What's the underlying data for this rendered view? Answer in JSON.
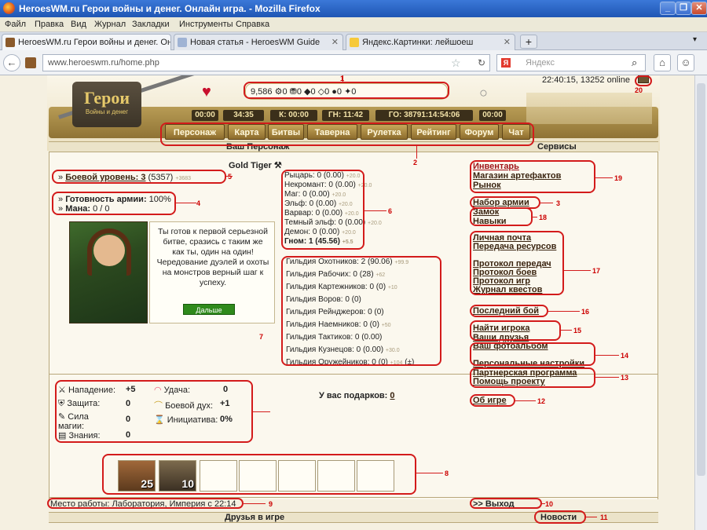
{
  "browser": {
    "window_title": "HeroesWM.ru Герои войны и денег. Онлайн игра. - Mozilla Firefox",
    "menu": [
      "Файл",
      "Правка",
      "Вид",
      "Журнал",
      "Закладки",
      "Инструменты",
      "Справка"
    ],
    "tabs": [
      {
        "label": "HeroesWM.ru Герои войны и денег. Он...",
        "active": true
      },
      {
        "label": "Новая статья - HeroesWM Guide",
        "active": false
      },
      {
        "label": "Яндекс.Картинки: лейшоеш",
        "active": false
      }
    ],
    "url": "www.heroeswm.ru/home.php",
    "search_placeholder": "Яндекс"
  },
  "header": {
    "logo_title": "Герои",
    "logo_subtitle": "Войны и денег",
    "clock_text": "22:40:15, 13252 online",
    "resources": "9,586 ⚙0 ⛃0 ◆0 ◇0 ●0 ✦0",
    "timers": [
      "00:00",
      "34:35",
      "К: 00:00",
      "ГН: 11:42",
      "ГО: 38791:14:54:06",
      "00:00"
    ],
    "nav": [
      "Персонаж",
      "Карта",
      "Битвы",
      "Таверна",
      "Рулетка",
      "Рейтинг",
      "Форум",
      "Чат"
    ]
  },
  "section": {
    "left_title": "Ваш Персонаж",
    "right_title": "Сервисы"
  },
  "hero": {
    "name": "Gold Tiger"
  },
  "level": {
    "label": "Боевой уровень: 3",
    "value": "(5357)",
    "extra": "+3683"
  },
  "readiness": {
    "label1": "Готовность армии:",
    "val1": "100%",
    "label2": "Мана:",
    "val2": "0 / 0"
  },
  "factions": [
    {
      "text": "Рыцарь: 0 (0.00)",
      "extra": "+20.0"
    },
    {
      "text": "Некромант: 0 (0.00)",
      "extra": "+20.0"
    },
    {
      "text": "Маг: 0 (0.00)",
      "extra": "+20.0"
    },
    {
      "text": "Эльф: 0 (0.00)",
      "extra": "+20.0"
    },
    {
      "text": "Варвар: 0 (0.00)",
      "extra": "+20.0"
    },
    {
      "text": "Темный эльф: 0 (0.00)",
      "extra": "+20.0"
    },
    {
      "text": "Демон: 0 (0.00)",
      "extra": "+20.0"
    },
    {
      "text": "Гном: 1 (45.56)",
      "extra": "+5.5"
    }
  ],
  "guilds": [
    {
      "text": "Гильдия Охотников: 2 (90.06)",
      "extra": "+99.9"
    },
    {
      "text": "Гильдия Рабочих: 0 (28)",
      "extra": "+62"
    },
    {
      "text": "Гильдия Картежников: 0 (0)",
      "extra": "+10"
    },
    {
      "text": "Гильдия Воров: 0 (0)",
      "extra": ""
    },
    {
      "text": "Гильдия Рейнджеров: 0 (0)",
      "extra": ""
    },
    {
      "text": "Гильдия Наемников: 0 (0)",
      "extra": "+50"
    },
    {
      "text": "Гильдия Тактиков: 0 (0.00)",
      "extra": ""
    },
    {
      "text": "Гильдия Кузнецов: 0 (0.00)",
      "extra": "+30.0"
    },
    {
      "text": "Гильдия Оружейников: 0 (0)",
      "extra": "+104"
    }
  ],
  "tutorial": {
    "text": "Ты готов к первой серьезной битве, сразись с таким же как ты, один на один! Чередование дуэлей и охоты на монстров верный шаг к успеху.",
    "button": "Дальше"
  },
  "stats": {
    "attack": {
      "label": "Нападение:",
      "value": "+5"
    },
    "defense": {
      "label": "Защита:",
      "value": "0"
    },
    "power": {
      "label": "Сила магии:",
      "value": "0"
    },
    "knowledge": {
      "label": "Знания:",
      "value": "0"
    },
    "luck": {
      "label": "Удача:",
      "value": "0"
    },
    "morale": {
      "label": "Боевой дух:",
      "value": "+1"
    },
    "initiative": {
      "label": "Инициатива:",
      "value": "0%"
    }
  },
  "gifts": {
    "label": "У вас подарков:",
    "value": "0"
  },
  "army": {
    "units": [
      {
        "count": "25",
        "name": "Dwarf"
      },
      {
        "count": "10",
        "name": "Dwarf Warrior"
      }
    ],
    "empty_slots": 5
  },
  "work": "Место работы: Лаборатория, Империя с 22:14",
  "exit": ">> Выход",
  "bottom": {
    "friends": "Друзья в игре",
    "news": "Новости"
  },
  "services": {
    "group19": [
      "Инвентарь",
      "Магазин артефактов",
      "Рынок"
    ],
    "army_set": "Набор армии",
    "group18": [
      "Замок",
      "Навыки"
    ],
    "group17": [
      "Личная почта",
      "Передача ресурсов",
      "",
      "Протокол передач",
      "Протокол боев",
      "Протокол игр",
      "Журнал квестов"
    ],
    "last_battle": "Последний бой",
    "group15": [
      "Найти игрока",
      "Ваши друзья"
    ],
    "group14": [
      "Ваш фотоальбом",
      "",
      "Персональные настройки"
    ],
    "group13": [
      "Партнерская программа",
      "Помощь проекту"
    ],
    "about": "Об игре"
  },
  "annotations": [
    "1",
    "2",
    "3",
    "4",
    "5",
    "6",
    "7",
    "8",
    "9",
    "10",
    "11",
    "12",
    "13",
    "14",
    "15",
    "16",
    "17",
    "18",
    "19",
    "20"
  ],
  "colors": {
    "annotation": "#d31b1b",
    "frame": "#c9b87d",
    "menu_gold": "#c7a85a"
  }
}
